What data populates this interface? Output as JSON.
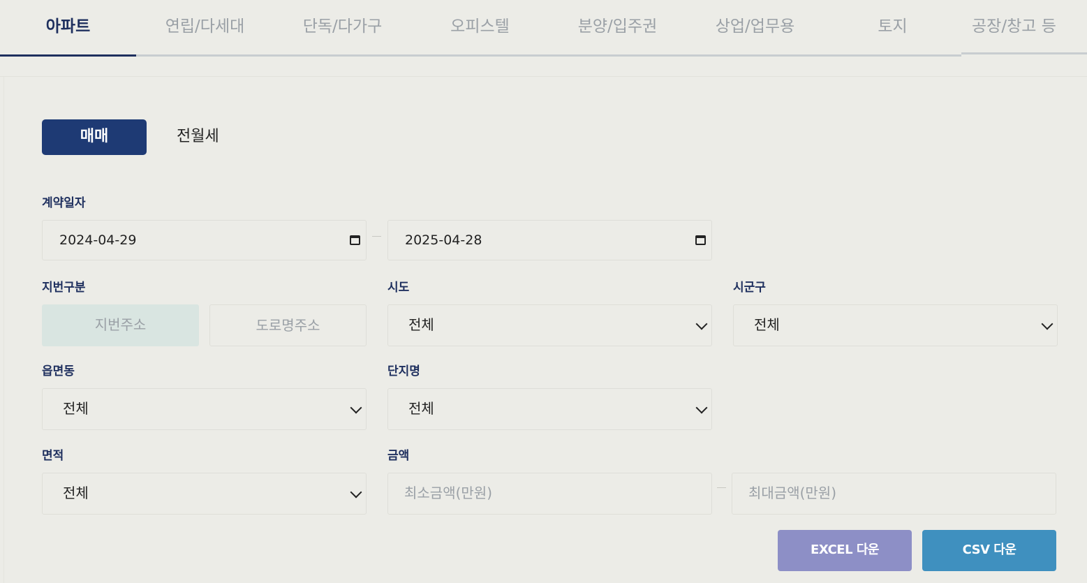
{
  "tabs": [
    {
      "label": "아파트",
      "active": true
    },
    {
      "label": "연립/다세대",
      "active": false
    },
    {
      "label": "단독/다가구",
      "active": false
    },
    {
      "label": "오피스텔",
      "active": false
    },
    {
      "label": "분양/입주권",
      "active": false
    },
    {
      "label": "상업/업무용",
      "active": false
    },
    {
      "label": "토지",
      "active": false
    },
    {
      "label": "공장/창고 등",
      "active": false
    }
  ],
  "deal_type": {
    "selected": "매매",
    "other": "전월세"
  },
  "contract_date": {
    "label": "계약일자",
    "start": "2024-04-29",
    "end": "2025-04-28"
  },
  "lot_type": {
    "label": "지번구분",
    "options": [
      "지번주소",
      "도로명주소"
    ],
    "selected": "지번주소"
  },
  "sido": {
    "label": "시도",
    "value": "전체"
  },
  "sigungu": {
    "label": "시군구",
    "value": "전체"
  },
  "eupmyeondong": {
    "label": "읍면동",
    "value": "전체"
  },
  "complex": {
    "label": "단지명",
    "value": "전체"
  },
  "area": {
    "label": "면적",
    "value": "전체"
  },
  "price": {
    "label": "금액",
    "min_placeholder": "최소금액(만원)",
    "max_placeholder": "최대금액(만원)"
  },
  "buttons": {
    "excel": "EXCEL 다운",
    "csv": "CSV 다운"
  },
  "colors": {
    "primary": "#1e3a74",
    "excel": "#8d8fc6",
    "csv": "#3f90bf",
    "segment_active": "#d9e5e1"
  }
}
